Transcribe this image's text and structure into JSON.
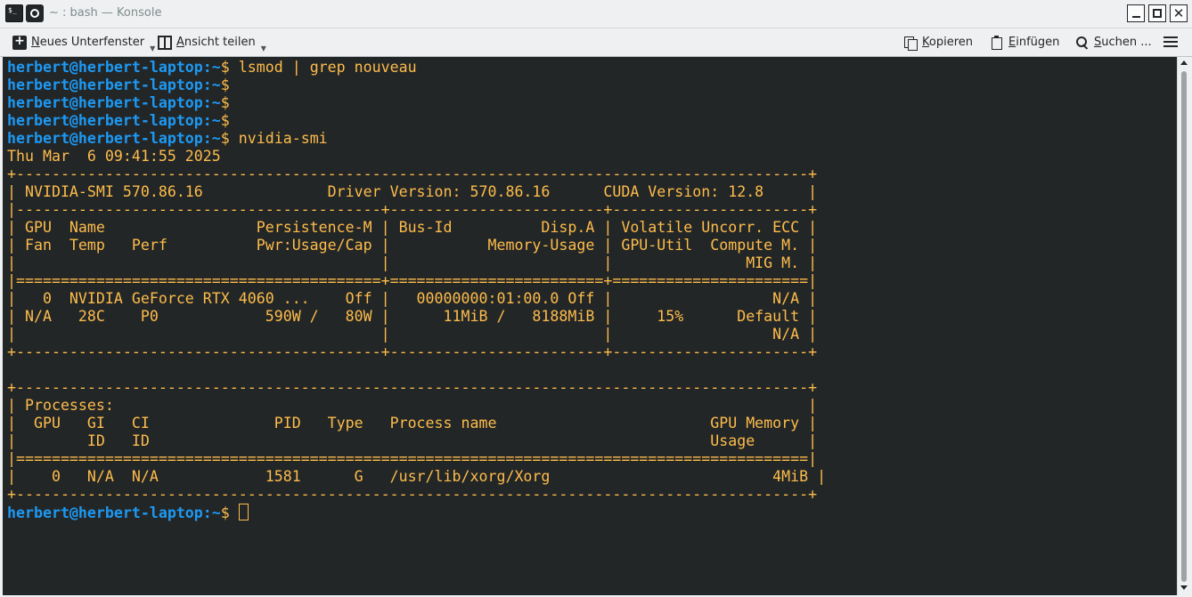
{
  "window": {
    "title": "~ : bash — Konsole",
    "app_icon_text": "$_",
    "close_glyph": "✕"
  },
  "toolbar": {
    "new_tab": "Neues Unterfenster",
    "split_view": "Ansicht teilen",
    "copy": "Kopieren",
    "paste": "Einfügen",
    "find": "Suchen ...",
    "icons": [
      "new-tab-icon",
      "split-view-icon",
      "copy-icon",
      "paste-icon",
      "search-icon",
      "hamburger-menu-icon"
    ]
  },
  "terminal": {
    "prompt_user_host": "herbert@herbert-laptop",
    "prompt_path": ":~",
    "prompt_symbol": "$",
    "commands": [
      "lsmod | grep nouveau",
      "",
      "",
      "",
      "nvidia-smi"
    ],
    "output_lines": [
      "Thu Mar  6 09:41:55 2025",
      "+-----------------------------------------------------------------------------------------+",
      "| NVIDIA-SMI 570.86.16              Driver Version: 570.86.16      CUDA Version: 12.8     |",
      "|-----------------------------------------+------------------------+----------------------+",
      "| GPU  Name                 Persistence-M | Bus-Id          Disp.A | Volatile Uncorr. ECC |",
      "| Fan  Temp   Perf          Pwr:Usage/Cap |           Memory-Usage | GPU-Util  Compute M. |",
      "|                                         |                        |               MIG M. |",
      "|=========================================+========================+======================|",
      "|   0  NVIDIA GeForce RTX 4060 ...    Off |   00000000:01:00.0 Off |                  N/A |",
      "| N/A   28C    P0            590W /   80W |      11MiB /   8188MiB |     15%      Default |",
      "|                                         |                        |                  N/A |",
      "+-----------------------------------------+------------------------+----------------------+",
      "",
      "+-----------------------------------------------------------------------------------------+",
      "| Processes:                                                                              |",
      "|  GPU   GI   CI              PID   Type   Process name                        GPU Memory |",
      "|        ID   ID                                                               Usage      |",
      "|=========================================================================================|",
      "|    0   N/A  N/A            1581      G   /usr/lib/xorg/Xorg                         4MiB |",
      "+-----------------------------------------------------------------------------------------+"
    ]
  },
  "colors": {
    "terminal_bg": "#232627",
    "terminal_fg": "#fdbc4b",
    "prompt": "#1d99f3",
    "chrome_bg": "#eff0f1"
  }
}
